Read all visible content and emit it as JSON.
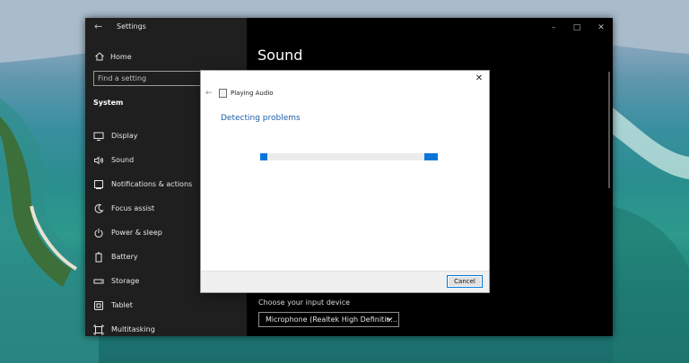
{
  "window": {
    "title": "Settings",
    "page_title": "Sound"
  },
  "sidebar": {
    "home_label": "Home",
    "search_placeholder": "Find a setting",
    "section_label": "System",
    "items": [
      {
        "label": "Display",
        "icon": "monitor-icon"
      },
      {
        "label": "Sound",
        "icon": "speaker-icon"
      },
      {
        "label": "Notifications & actions",
        "icon": "notifications-icon"
      },
      {
        "label": "Focus assist",
        "icon": "moon-icon"
      },
      {
        "label": "Power & sleep",
        "icon": "power-icon"
      },
      {
        "label": "Battery",
        "icon": "battery-icon"
      },
      {
        "label": "Storage",
        "icon": "storage-icon"
      },
      {
        "label": "Tablet",
        "icon": "tablet-icon"
      },
      {
        "label": "Multitasking",
        "icon": "multitasking-icon"
      }
    ]
  },
  "sound": {
    "input_device_label": "Choose your input device",
    "input_device_value": "Microphone (Realtek High Definitio..."
  },
  "dialog": {
    "app_title": "Playing Audio",
    "heading": "Detecting problems",
    "cancel_label": "Cancel",
    "accent_color": "#0b76d9"
  }
}
